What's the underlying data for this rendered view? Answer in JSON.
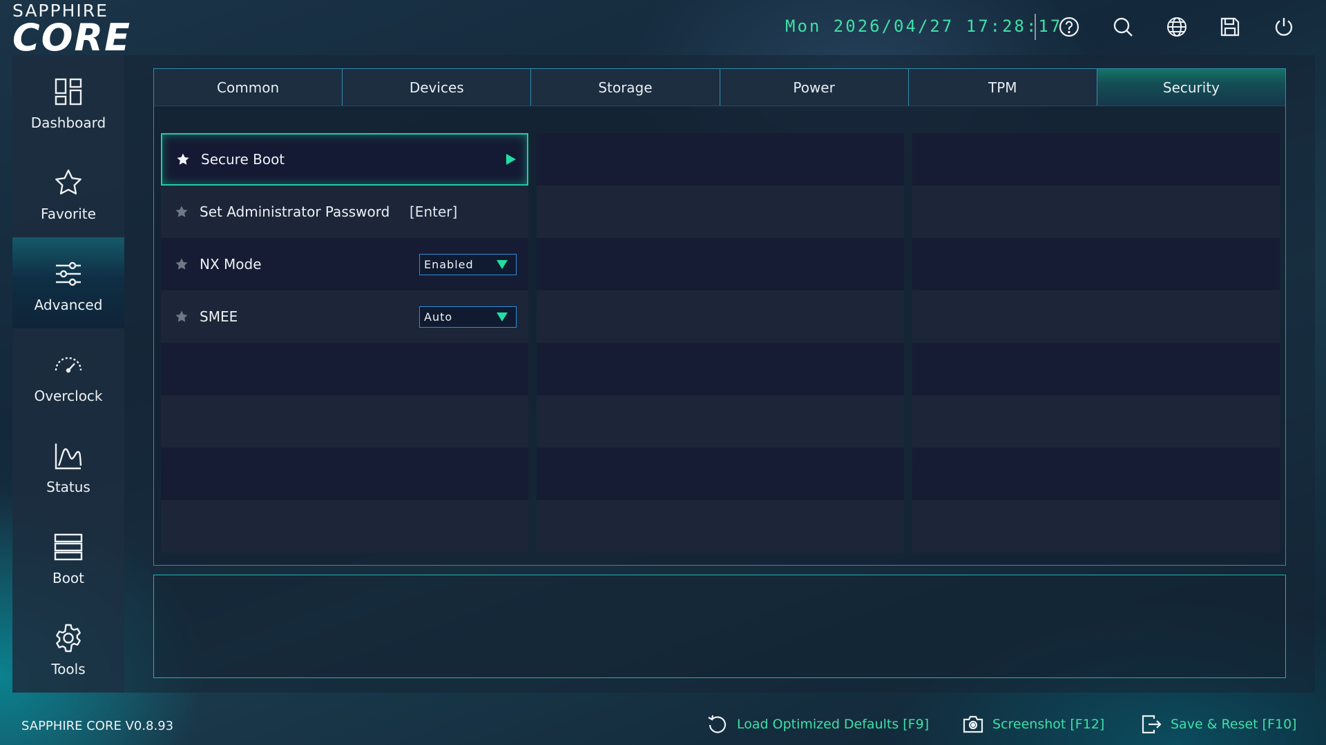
{
  "brand": {
    "top": "SAPPHIRE",
    "bottom": "CORE"
  },
  "header": {
    "datetime": "Mon 2026/04/27 17:28:17",
    "icons": [
      "help-icon",
      "search-icon",
      "globe-icon",
      "save-icon",
      "power-icon"
    ],
    "accent_color": "#3fe0a8"
  },
  "sidebar": {
    "items": [
      {
        "label": "Dashboard",
        "icon": "dashboard-icon"
      },
      {
        "label": "Favorite",
        "icon": "star-icon"
      },
      {
        "label": "Advanced",
        "icon": "sliders-icon",
        "active": true
      },
      {
        "label": "Overclock",
        "icon": "speedometer-icon"
      },
      {
        "label": "Status",
        "icon": "chart-icon"
      },
      {
        "label": "Boot",
        "icon": "boot-icon"
      },
      {
        "label": "Tools",
        "icon": "gear-icon"
      }
    ]
  },
  "tabs": [
    {
      "label": "Common"
    },
    {
      "label": "Devices"
    },
    {
      "label": "Storage"
    },
    {
      "label": "Power"
    },
    {
      "label": "TPM"
    },
    {
      "label": "Security",
      "active": true
    }
  ],
  "settings": [
    {
      "label": "Secure Boot",
      "type": "submenu",
      "selected": true
    },
    {
      "label": "Set Administrator Password",
      "type": "action",
      "value": "[Enter]"
    },
    {
      "label": "NX Mode",
      "type": "dropdown",
      "value": "Enabled"
    },
    {
      "label": "SMEE",
      "type": "dropdown",
      "value": "Auto"
    }
  ],
  "footer": {
    "version": "SAPPHIRE CORE V0.8.93",
    "actions": [
      {
        "label": "Load Optimized Defaults [F9]",
        "icon": "reset-icon"
      },
      {
        "label": "Screenshot [F12]",
        "icon": "camera-icon"
      },
      {
        "label": "Save & Reset [F10]",
        "icon": "exit-icon"
      }
    ]
  }
}
